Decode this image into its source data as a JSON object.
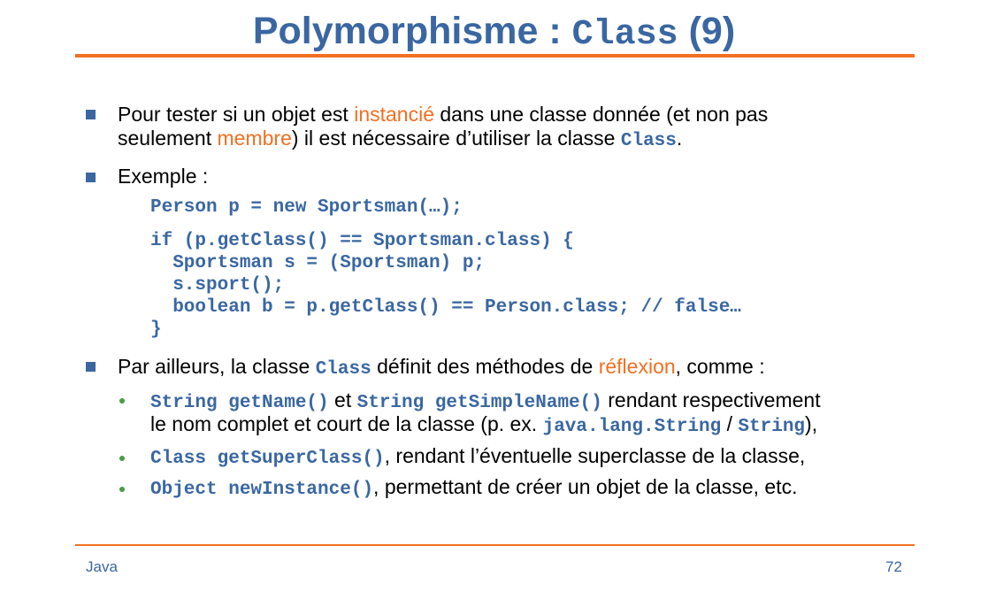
{
  "slide": {
    "title_prefix": "Polymorphisme :",
    "title_code": "Class",
    "title_suffix": "(9)",
    "footer_left": "Java",
    "page_number": "72"
  },
  "bullets": {
    "b1": {
      "line1_a": "Pour tester si un objet est",
      "line1_hl": "instancié",
      "line1_b": "dans une classe donnée (et non pas",
      "line2_a": "seulement",
      "line2_hl": "membre",
      "line2_b": ") il est nécessaire d’utiliser la classe",
      "line2_code": "Class",
      "line2_end": "."
    },
    "b2": {
      "label": "Exemple :",
      "code_line1": "Person p = new Sportsman(…);",
      "code_block": "if (p.getClass() == Sportsman.class) {\n  Sportsman s = (Sportsman) p;\n  s.sport();\n  boolean b = p.getClass() == Person.class; // false…\n}"
    },
    "b3": {
      "text_a": "Par ailleurs, la classe",
      "code": "Class",
      "text_b": "définit des méthodes de",
      "hl": "réflexion",
      "text_c": ", comme :"
    }
  },
  "sub_bullets": {
    "s1": {
      "code1": "String getName()",
      "text1": "et",
      "code2": "String getSimpleName()",
      "text2": "rendant respectivement",
      "line2_text": "le nom complet et court de la classe (p. ex.",
      "code3": "java.lang.String",
      "sep": "/",
      "code4": "String",
      "end": "),"
    },
    "s2": {
      "code": "Class getSuperClass()",
      "text": ", rendant l’éventuelle superclasse de la classe,"
    },
    "s3": {
      "code": "Object newInstance()",
      "text": ", permettant de créer un objet de la classe, etc."
    }
  },
  "colors": {
    "title_blue": "#3a67a2",
    "accent_orange": "#f36f21",
    "sub_bullet_green": "#4a9a4a"
  }
}
